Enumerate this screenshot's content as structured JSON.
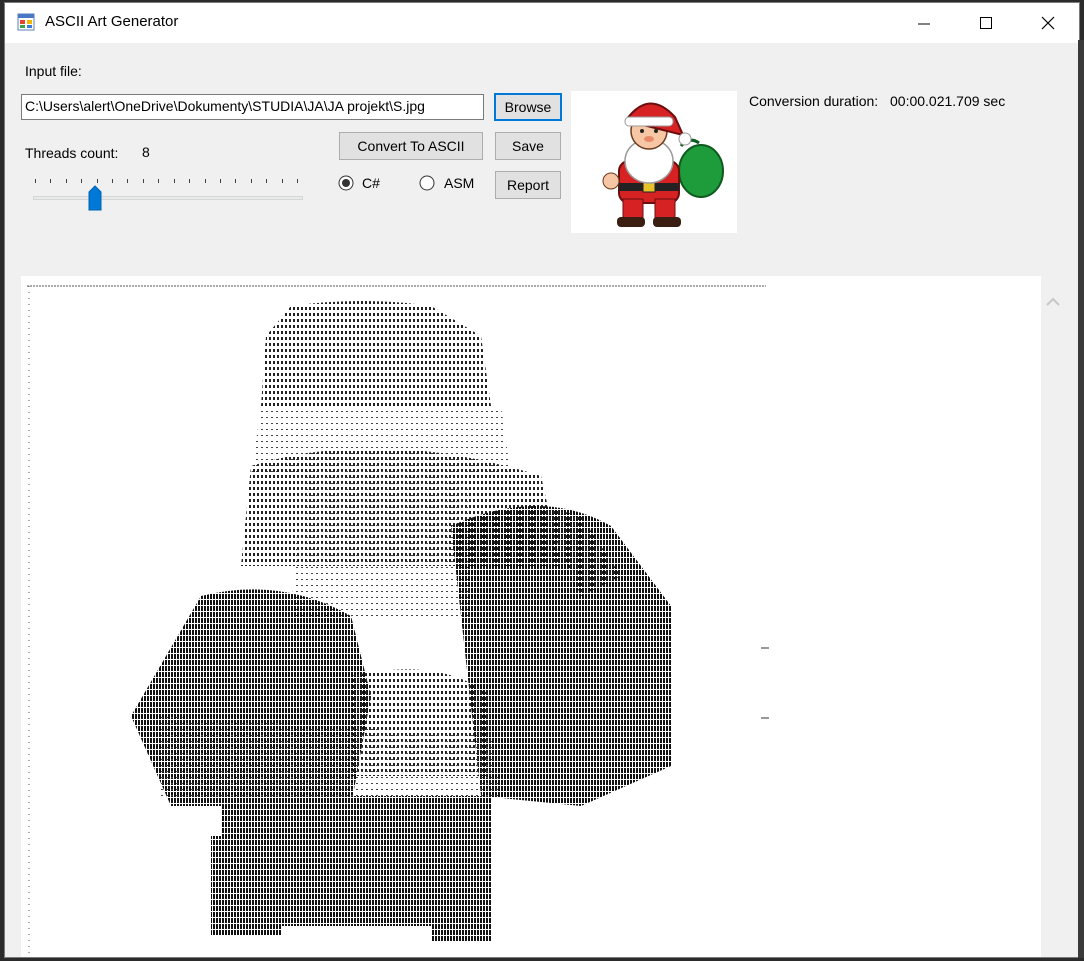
{
  "window": {
    "title": "ASCII Art  Generator",
    "buttons": {
      "minimize": "—",
      "maximize": "☐",
      "close": "✕"
    }
  },
  "input": {
    "label": "Input file:",
    "path": "C:\\Users\\alert\\OneDrive\\Dokumenty\\STUDIA\\JA\\JA projekt\\S.jpg"
  },
  "buttons": {
    "browse": "Browse",
    "convert": "Convert To ASCII",
    "save": "Save",
    "report": "Report"
  },
  "threads": {
    "label": "Threads count:",
    "value": "8",
    "slider_min": 1,
    "slider_max": 64,
    "slider_value": 8
  },
  "implementation": {
    "options": [
      "C#",
      "ASM"
    ],
    "selected": "C#"
  },
  "conversion": {
    "label": "Conversion duration:",
    "value": "00:00.021.709 sec"
  },
  "colors": {
    "accent": "#0078d7",
    "window_bg": "#f0f0f0",
    "button_bg": "#e1e1e1"
  },
  "icons": {
    "app": "app-windows-icon",
    "scroll_up": "chevron-up-icon"
  }
}
